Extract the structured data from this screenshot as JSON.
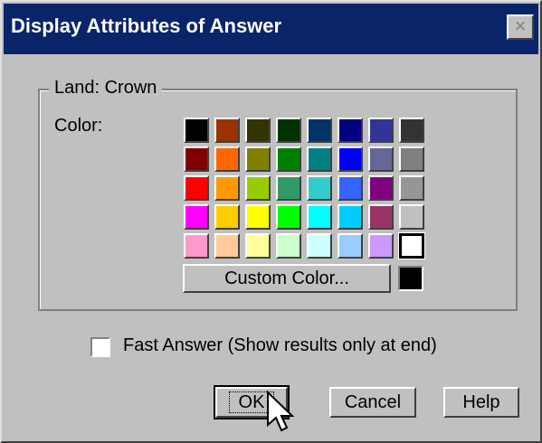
{
  "window": {
    "title": "Display Attributes of Answer",
    "close_glyph": "×"
  },
  "group": {
    "legend": "Land: Crown",
    "color_label": "Color:"
  },
  "palette": [
    [
      "#000000",
      "#993300",
      "#333300",
      "#003300",
      "#003366",
      "#000080",
      "#333399",
      "#333333"
    ],
    [
      "#800000",
      "#ff6600",
      "#808000",
      "#008000",
      "#008080",
      "#0000ff",
      "#666699",
      "#808080"
    ],
    [
      "#ff0000",
      "#ff9900",
      "#99cc00",
      "#339966",
      "#33cccc",
      "#3366ff",
      "#800080",
      "#969696"
    ],
    [
      "#ff00ff",
      "#ffcc00",
      "#ffff00",
      "#00ff00",
      "#00ffff",
      "#00ccff",
      "#993366",
      "#c0c0c0"
    ],
    [
      "#ff99cc",
      "#ffcc99",
      "#ffff99",
      "#ccffcc",
      "#ccffff",
      "#99ccff",
      "#cc99ff",
      "#ffffff"
    ]
  ],
  "selected_color": "#ffffff",
  "custom_color": {
    "label": "Custom Color...",
    "current": "#000000"
  },
  "fast_answer": {
    "label": "Fast Answer (Show results only at end)",
    "checked": false
  },
  "buttons": {
    "ok": "OK",
    "cancel": "Cancel",
    "help": "Help"
  }
}
